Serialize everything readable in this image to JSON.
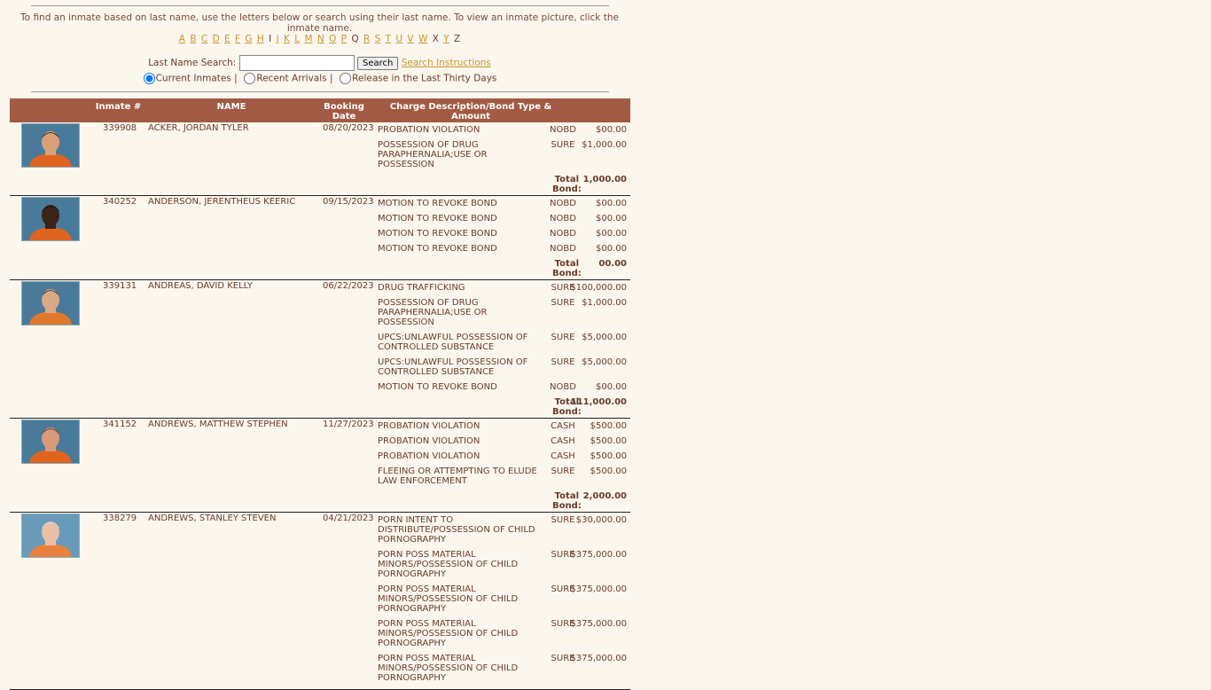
{
  "intro_text": "To find an inmate based on last name, use the letters below or search using their last name.  To view an inmate picture, click the inmate name.",
  "letters": [
    {
      "l": "A",
      "link": true
    },
    {
      "l": "B",
      "link": true
    },
    {
      "l": "C",
      "link": true
    },
    {
      "l": "D",
      "link": true
    },
    {
      "l": "E",
      "link": true
    },
    {
      "l": "F",
      "link": true
    },
    {
      "l": "G",
      "link": true
    },
    {
      "l": "H",
      "link": true
    },
    {
      "l": "I",
      "link": false
    },
    {
      "l": "J",
      "link": true
    },
    {
      "l": "K",
      "link": true
    },
    {
      "l": "L",
      "link": true
    },
    {
      "l": "M",
      "link": true
    },
    {
      "l": "N",
      "link": true
    },
    {
      "l": "O",
      "link": true
    },
    {
      "l": "P",
      "link": true
    },
    {
      "l": "Q",
      "link": false
    },
    {
      "l": "R",
      "link": true
    },
    {
      "l": "S",
      "link": true
    },
    {
      "l": "T",
      "link": true
    },
    {
      "l": "U",
      "link": true
    },
    {
      "l": "V",
      "link": true
    },
    {
      "l": "W",
      "link": true
    },
    {
      "l": "X",
      "link": false
    },
    {
      "l": "Y",
      "link": true
    },
    {
      "l": "Z",
      "link": false
    }
  ],
  "search": {
    "label": "Last Name Search:",
    "value": "",
    "button": "Search",
    "instructions": "Search Instructions"
  },
  "radios": {
    "current": "Current Inmates |",
    "recent": "Recent Arrivals |",
    "release": "Release in the Last Thirty Days",
    "selected": "current"
  },
  "columns": {
    "photo": "",
    "inmate": "Inmate #",
    "name": "NAME",
    "booking": "Booking Date",
    "charge": "Charge Description/Bond Type & Amount"
  },
  "total_label": "Total Bond:",
  "inmates": [
    {
      "number": "339908",
      "name": "ACKER, JORDAN TYLER",
      "date": "08/20/2023",
      "photo": {
        "bg": "#4a7a9a",
        "skin": "#d9a07a",
        "hair": "#3a2a20",
        "shirt": "#e0641e"
      },
      "charges": [
        {
          "desc": "PROBATION VIOLATION",
          "type": "NOBD",
          "amount": "$00.00"
        },
        {
          "desc": "POSSESSION OF DRUG PARAPHERNALIA;USE OR POSSESSION",
          "type": "SURE",
          "amount": "$1,000.00"
        }
      ],
      "total": "1,000.00"
    },
    {
      "number": "340252",
      "name": "ANDERSON, JERENTHEUS KEERIC",
      "date": "09/15/2023",
      "photo": {
        "bg": "#4a7a9a",
        "skin": "#3a2418",
        "hair": "#1a1010",
        "shirt": "#e0641e"
      },
      "charges": [
        {
          "desc": "MOTION TO REVOKE BOND",
          "type": "NOBD",
          "amount": "$00.00"
        },
        {
          "desc": "MOTION TO REVOKE BOND",
          "type": "NOBD",
          "amount": "$00.00"
        },
        {
          "desc": "MOTION TO REVOKE BOND",
          "type": "NOBD",
          "amount": "$00.00"
        },
        {
          "desc": "MOTION TO REVOKE BOND",
          "type": "NOBD",
          "amount": "$00.00"
        }
      ],
      "total": "00.00"
    },
    {
      "number": "339131",
      "name": "ANDREAS, DAVID KELLY",
      "date": "06/22/2023",
      "photo": {
        "bg": "#4a7a9a",
        "skin": "#d8a888",
        "hair": "#4a3a30",
        "shirt": "#e0782e"
      },
      "charges": [
        {
          "desc": "DRUG TRAFFICKING",
          "type": "SURE",
          "amount": "$100,000.00"
        },
        {
          "desc": "POSSESSION OF DRUG PARAPHERNALIA;USE OR POSSESSION",
          "type": "SURE",
          "amount": "$1,000.00"
        },
        {
          "desc": "UPCS:UNLAWFUL POSSESSION OF CONTROLLED SUBSTANCE",
          "type": "SURE",
          "amount": "$5,000.00"
        },
        {
          "desc": "UPCS:UNLAWFUL POSSESSION OF CONTROLLED SUBSTANCE",
          "type": "SURE",
          "amount": "$5,000.00"
        },
        {
          "desc": "MOTION TO REVOKE BOND",
          "type": "NOBD",
          "amount": "$00.00"
        }
      ],
      "total": "111,000.00"
    },
    {
      "number": "341152",
      "name": "ANDREWS, MATTHEW STEPHEN",
      "date": "11/27/2023",
      "photo": {
        "bg": "#4a7a9a",
        "skin": "#d89a78",
        "hair": "#5a4030",
        "shirt": "#e0641e"
      },
      "charges": [
        {
          "desc": "PROBATION VIOLATION",
          "type": "CASH",
          "amount": "$500.00"
        },
        {
          "desc": "PROBATION VIOLATION",
          "type": "CASH",
          "amount": "$500.00"
        },
        {
          "desc": "PROBATION VIOLATION",
          "type": "CASH",
          "amount": "$500.00"
        },
        {
          "desc": "FLEEING OR ATTEMPTING TO ELUDE LAW ENFORCEMENT",
          "type": "SURE",
          "amount": "$500.00"
        }
      ],
      "total": "2,000.00"
    },
    {
      "number": "338279",
      "name": "ANDREWS, STANLEY STEVEN",
      "date": "04/21/2023",
      "photo": {
        "bg": "#6a9aba",
        "skin": "#e8c0a8",
        "hair": "#d8d8d8",
        "shirt": "#e8823a"
      },
      "charges": [
        {
          "desc": "PORN INTENT TO DISTRIBUTE/POSSESSION OF CHILD PORNOGRAPHY",
          "type": "SURE",
          "amount": "$30,000.00"
        },
        {
          "desc": "PORN POSS MATERIAL MINORS/POSSESSION OF CHILD PORNOGRAPHY",
          "type": "SURE",
          "amount": "$375,000.00"
        },
        {
          "desc": "PORN POSS MATERIAL MINORS/POSSESSION OF CHILD PORNOGRAPHY",
          "type": "SURE",
          "amount": "$375,000.00"
        },
        {
          "desc": "PORN POSS MATERIAL MINORS/POSSESSION OF CHILD PORNOGRAPHY",
          "type": "SURE",
          "amount": "$375,000.00"
        },
        {
          "desc": "PORN POSS MATERIAL MINORS/POSSESSION OF CHILD PORNOGRAPHY",
          "type": "SURE",
          "amount": "$375,000.00"
        }
      ],
      "total": ""
    }
  ]
}
